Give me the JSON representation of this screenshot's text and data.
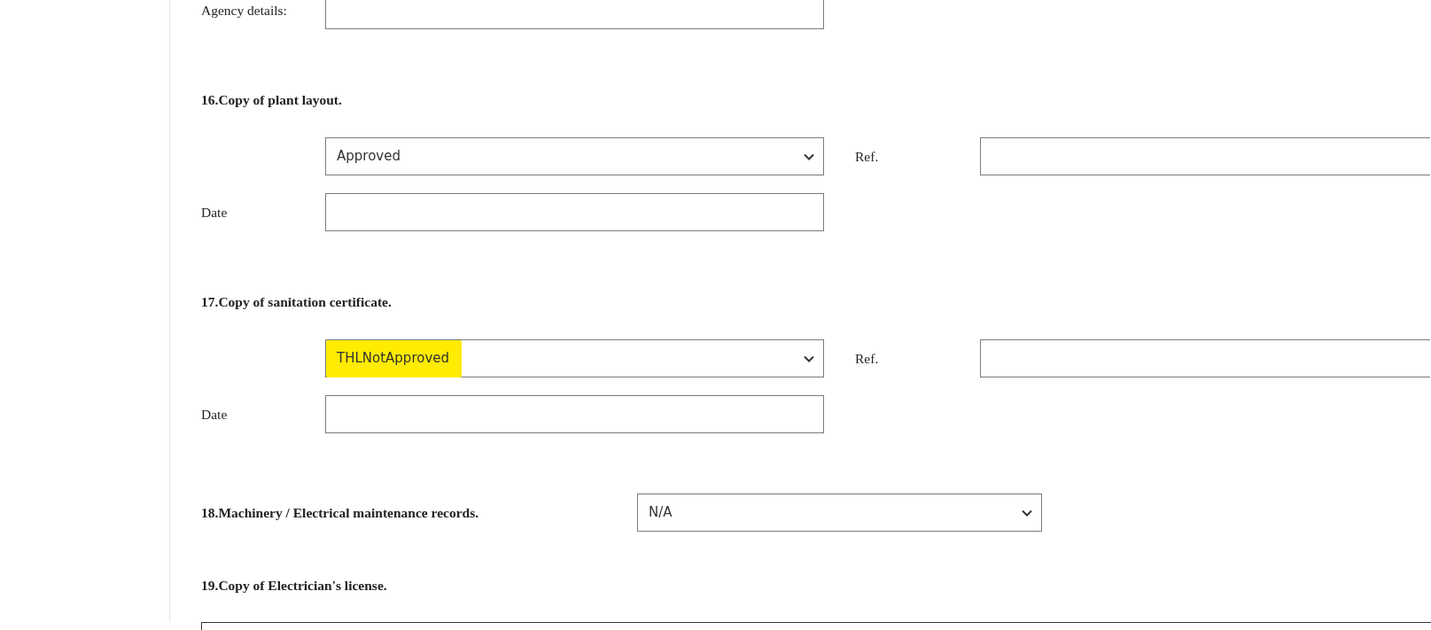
{
  "agency": {
    "label": "Agency details:"
  },
  "sections": [
    {
      "kind": "status_ref_date",
      "title": "16.Copy of plant layout.",
      "status": {
        "value": "Approved",
        "highlighted": false
      },
      "ref_label": "Ref.",
      "date_label": "Date"
    },
    {
      "kind": "status_ref_date",
      "title": "17.Copy of sanitation certificate.",
      "status": {
        "value": "THLNotApproved",
        "highlighted": true
      },
      "ref_label": "Ref.",
      "date_label": "Date"
    },
    {
      "kind": "inline_select",
      "title": "18.Machinery / Electrical maintenance records.",
      "status": {
        "value": "N/A",
        "highlighted": false
      }
    },
    {
      "kind": "field_below",
      "title": "19.Copy of Electrician's license."
    }
  ]
}
